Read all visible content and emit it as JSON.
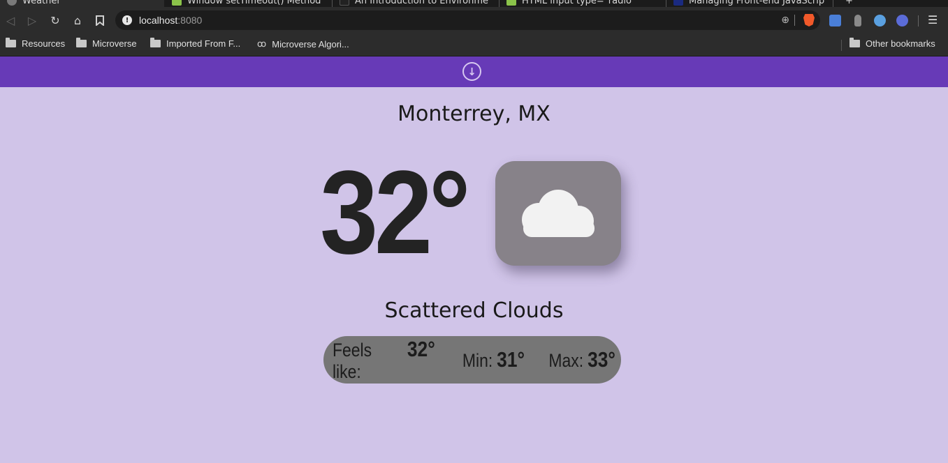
{
  "browser": {
    "tabs": [
      {
        "label": "Weather",
        "favicon_color": "#7a7a7a",
        "active": true
      },
      {
        "label": "Window setTimeout() Method",
        "favicon_color": "#8bc34a",
        "active": false
      },
      {
        "label": "An Introduction to Environme",
        "favicon_color": "#222222",
        "active": false
      },
      {
        "label": "HTML input type=\"radio\"",
        "favicon_color": "#8bc34a",
        "active": false
      },
      {
        "label": "Managing Front-end JavaScrip",
        "favicon_color": "#1a2a80",
        "active": false
      }
    ],
    "url_host": "localhost",
    "url_port": ":8080",
    "bookmarks": [
      {
        "label": "Resources",
        "icon": "folder-icon"
      },
      {
        "label": "Microverse",
        "icon": "folder-icon"
      },
      {
        "label": "Imported From F...",
        "icon": "folder-icon"
      },
      {
        "label": "Microverse Algori...",
        "icon": "microverse-icon"
      }
    ],
    "other_bookmarks": "Other bookmarks"
  },
  "weather": {
    "city": "Monterrey, MX",
    "temperature": "32°",
    "icon": "cloud-icon",
    "description": "Scattered Clouds",
    "feels_like_label": "Feels like:",
    "feels_like_value": "32°",
    "min_label": "Min:",
    "min_value": "31°",
    "max_label": "Max:",
    "max_value": "33°"
  },
  "colors": {
    "header_bar": "#673ab7",
    "page_background": "#d0c4e8",
    "icon_card": "#878289",
    "details_pill": "#767676"
  }
}
